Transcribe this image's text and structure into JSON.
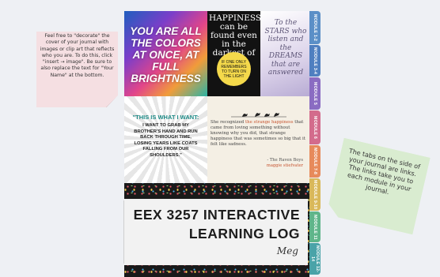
{
  "notes": {
    "left": "Feel free to \"decorate\" the cover of your journal with images or clip art that reflects who you are. To do this, click \"insert → image\". Be sure to also replace the text for \"Your Name\" at the bottom.",
    "right": "The tabs on the side of your journal are links. The links take you to each module in your journal."
  },
  "quotes": {
    "colors": "YOU ARE ALL THE COLORS AT ONCE, AT FULL BRIGHTNESS",
    "happiness": "HAPPINESS can be found even in the darkest of times",
    "happiness_badge": "IF ONE ONLY REMEMBERS TO TURN ON THE LIGHT",
    "stars": "To the STARS who listen and the DREAMS that are answered",
    "want_head": "\"THIS IS WHAT I WANT:",
    "want_body": "I WANT TO GRAB MY BROTHER'S HAND AND RUN BACK THROUGH TIME, LOSING YEARS LIKE COATS FALLING FROM OUR SHOULDERS.\"",
    "raven_pre": "She recognized ",
    "raven_hl": "the strange happiness",
    "raven_post": " that came from loving something without knowing why you did, that strange happiness that was sometimes so big that it felt like sadness.",
    "raven_cite": "- The Raven Boys",
    "raven_author": "maggie stiefvater"
  },
  "title": {
    "line1": "EEX 3257 INTERACTIVE",
    "line2": "LEARNING LOG",
    "name": "Meg"
  },
  "tabs": [
    {
      "label": "MODULE 1-2",
      "color": "#5b8fc7"
    },
    {
      "label": "MODULE 3-4",
      "color": "#4f7fc0"
    },
    {
      "label": "MODULE 5",
      "color": "#8a6cc2"
    },
    {
      "label": "MODULE 6",
      "color": "#d36b8c"
    },
    {
      "label": "MODULE 7-8",
      "color": "#e78a5b"
    },
    {
      "label": "MODULE 9-10",
      "color": "#d9b85a"
    },
    {
      "label": "MODULE 11",
      "color": "#5fb58a"
    },
    {
      "label": "MODULE 12-14",
      "color": "#4aa3a8"
    }
  ]
}
